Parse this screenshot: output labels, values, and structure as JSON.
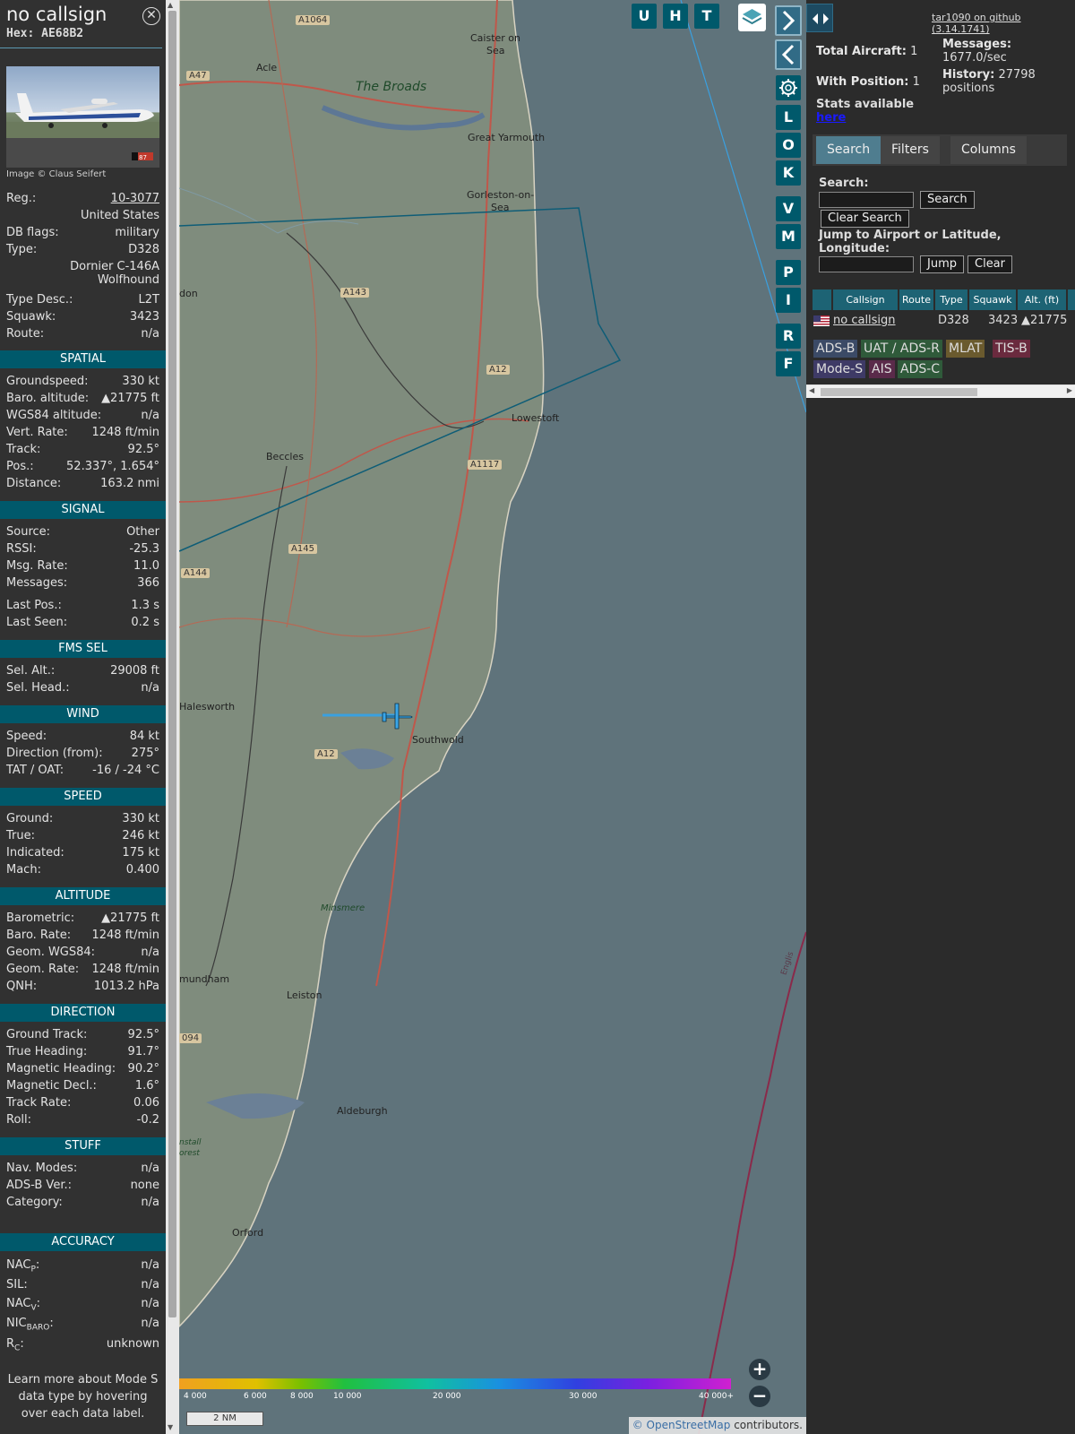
{
  "sidebar": {
    "title": "no callsign",
    "hex": "Hex: AE68B2",
    "photo_credit": "Image © Claus Seifert",
    "photo_tag": "87",
    "reg_label": "Reg.:",
    "reg_value": "10-3077",
    "country": "United States",
    "db_flags_label": "DB flags:",
    "db_flags_value": "military",
    "type_label": "Type:",
    "type_value": "D328",
    "type_name_line1": "Dornier C-146A",
    "type_name_line2": "Wolfhound",
    "type_desc_label": "Type Desc.:",
    "type_desc_value": "L2T",
    "squawk_label": "Squawk:",
    "squawk_value": "3423",
    "route_label": "Route:",
    "route_value": "n/a",
    "spatial": {
      "header": "SPATIAL",
      "rows": [
        {
          "k": "Groundspeed:",
          "v": "330 kt"
        },
        {
          "k": "Baro. altitude:",
          "v": "▲21775 ft"
        },
        {
          "k": "WGS84 altitude:",
          "v": "n/a"
        },
        {
          "k": "Vert. Rate:",
          "v": "1248 ft/min"
        },
        {
          "k": "Track:",
          "v": "92.5°"
        },
        {
          "k": "Pos.:",
          "v": "52.337°, 1.654°"
        },
        {
          "k": "Distance:",
          "v": "163.2 nmi"
        }
      ]
    },
    "signal": {
      "header": "SIGNAL",
      "rows": [
        {
          "k": "Source:",
          "v": "Other"
        },
        {
          "k": "RSSI:",
          "v": "-25.3"
        },
        {
          "k": "Msg. Rate:",
          "v": "11.0"
        },
        {
          "k": "Messages:",
          "v": "366"
        },
        {
          "k": "Last Pos.:",
          "v": "1.3 s"
        },
        {
          "k": "Last Seen:",
          "v": "0.2 s"
        }
      ]
    },
    "fms": {
      "header": "FMS SEL",
      "rows": [
        {
          "k": "Sel. Alt.:",
          "v": "29008 ft"
        },
        {
          "k": "Sel. Head.:",
          "v": "n/a"
        }
      ]
    },
    "wind": {
      "header": "WIND",
      "rows": [
        {
          "k": "Speed:",
          "v": "84 kt"
        },
        {
          "k": "Direction (from):",
          "v": "275°"
        },
        {
          "k": "TAT / OAT:",
          "v": "-16 / -24 °C"
        }
      ]
    },
    "speed": {
      "header": "SPEED",
      "rows": [
        {
          "k": "Ground:",
          "v": "330 kt"
        },
        {
          "k": "True:",
          "v": "246 kt"
        },
        {
          "k": "Indicated:",
          "v": "175 kt"
        },
        {
          "k": "Mach:",
          "v": "0.400"
        }
      ]
    },
    "altitude": {
      "header": "ALTITUDE",
      "rows": [
        {
          "k": "Barometric:",
          "v": "▲21775 ft"
        },
        {
          "k": "Baro. Rate:",
          "v": "1248 ft/min"
        },
        {
          "k": "Geom. WGS84:",
          "v": "n/a"
        },
        {
          "k": "Geom. Rate:",
          "v": "1248 ft/min"
        },
        {
          "k": "QNH:",
          "v": "1013.2 hPa"
        }
      ]
    },
    "direction": {
      "header": "DIRECTION",
      "rows": [
        {
          "k": "Ground Track:",
          "v": "92.5°"
        },
        {
          "k": "True Heading:",
          "v": "91.7°"
        },
        {
          "k": "Magnetic Heading:",
          "v": "90.2°"
        },
        {
          "k": "Magnetic Decl.:",
          "v": "1.6°"
        },
        {
          "k": "Track Rate:",
          "v": "0.06"
        },
        {
          "k": "Roll:",
          "v": "-0.2"
        }
      ]
    },
    "stuff": {
      "header": "STUFF",
      "rows": [
        {
          "k": "Nav. Modes:",
          "v": "n/a"
        },
        {
          "k": "ADS-B Ver.:",
          "v": "none"
        },
        {
          "k": "Category:",
          "v": "n/a"
        }
      ]
    },
    "accuracy": {
      "header": "ACCURACY",
      "rows": [
        {
          "k": "NAC",
          "sub": "P",
          "v": "n/a"
        },
        {
          "k": "SIL:",
          "sub": "",
          "v": "n/a"
        },
        {
          "k": "NAC",
          "sub": "V",
          "v": "n/a"
        },
        {
          "k": "NIC",
          "sub": "BARO",
          "v": "n/a"
        },
        {
          "k": "R",
          "sub": "C",
          "v": "unknown"
        }
      ]
    },
    "footer": "Learn more about Mode S data type by hovering over each data label."
  },
  "map": {
    "buttons_top": [
      "U",
      "H",
      "T"
    ],
    "buttons_side": [
      "L",
      "O",
      "K",
      "V",
      "M",
      "P",
      "I",
      "R",
      "F"
    ],
    "place_labels": [
      {
        "t": "A1064"
      },
      {
        "t": "Caister on"
      },
      {
        "t": "Sea"
      },
      {
        "t": "A47"
      },
      {
        "t": "Acle"
      },
      {
        "t": "The Broads"
      },
      {
        "t": "Great Yarmouth"
      },
      {
        "t": "Gorleston-on-"
      },
      {
        "t": "Sea"
      },
      {
        "t": "A143"
      },
      {
        "t": "don"
      },
      {
        "t": "A12"
      },
      {
        "t": "Lowestoft"
      },
      {
        "t": "Beccles"
      },
      {
        "t": "A1117"
      },
      {
        "t": "A145"
      },
      {
        "t": "A144"
      },
      {
        "t": "Halesworth"
      },
      {
        "t": "Southwold"
      },
      {
        "t": "A12"
      },
      {
        "t": "Minsmere"
      },
      {
        "t": "mundham"
      },
      {
        "t": "Leiston"
      },
      {
        "t": "094"
      },
      {
        "t": "Aldeburgh"
      },
      {
        "t": "nstall"
      },
      {
        "t": "orest"
      },
      {
        "t": "Orford"
      },
      {
        "t": "Englis"
      }
    ],
    "colorbar_labels": [
      "4 000",
      "6 000",
      "8 000",
      "10 000",
      "20 000",
      "30 000",
      "40 000+"
    ],
    "scale": "2 NM",
    "attribution_prefix": "© ",
    "attribution_link": "OpenStreetMap",
    "attribution_suffix": " contributors.",
    "zoom_in": "+",
    "zoom_out": "−"
  },
  "panel": {
    "github_link": "tar1090 on github (3.14.1741)",
    "total_aircraft_label": "Total Aircraft:",
    "total_aircraft_value": "1",
    "messages_label": "Messages:",
    "messages_value": "1677.0/sec",
    "with_position_label": "With Position:",
    "with_position_value": "1",
    "history_label": "History:",
    "history_value": "27798",
    "history_unit": "positions",
    "stats_label": "Stats available",
    "stats_link": "here",
    "tabs": [
      "Search",
      "Filters",
      "Columns"
    ],
    "search_label": "Search:",
    "search_button": "Search",
    "clear_search_button": "Clear Search",
    "jump_label_line1": "Jump to Airport or Latitude,",
    "jump_label_line2": "Longitude:",
    "jump_button": "Jump",
    "clear_button": "Clear",
    "table_headers": [
      "Callsign",
      "Route",
      "Type",
      "Squawk",
      "Alt. (ft)"
    ],
    "table_rows": [
      {
        "callsign": "no callsign",
        "route": "",
        "type": "D328",
        "squawk": "3423",
        "alt": "▲21775"
      }
    ],
    "badges": [
      "ADS-B",
      "UAT / ADS-R",
      "MLAT",
      "TIS-B",
      "Mode-S",
      "AIS",
      "ADS-C"
    ]
  }
}
